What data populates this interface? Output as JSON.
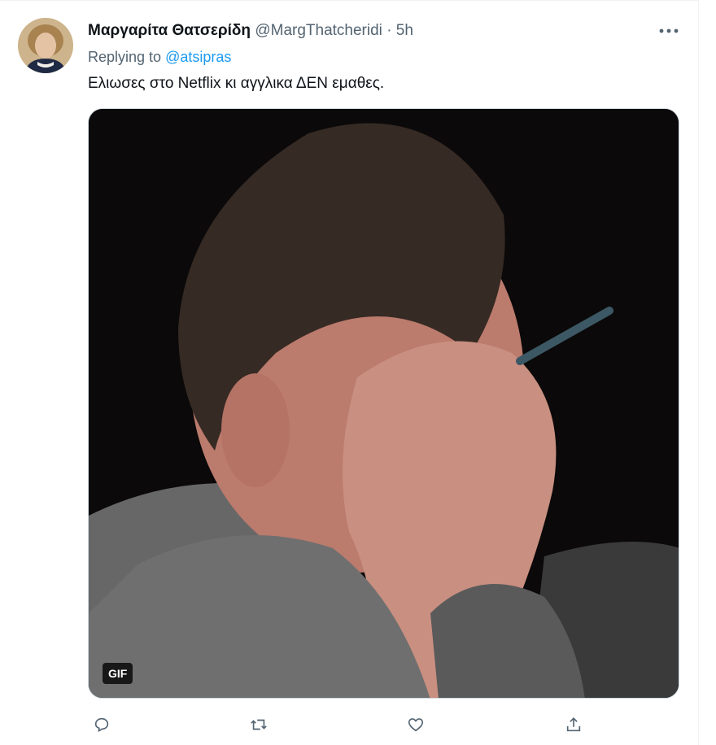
{
  "tweet": {
    "display_name": "Μαργαρίτα Θατσερίδη",
    "handle": "@MargThatcheridi",
    "separator": "·",
    "time": "5h",
    "replying_prefix": "Replying to",
    "replying_to": "@atsipras",
    "text": "Ελιωσες στο Netflix κι αγγλικα ΔΕΝ εμαθες.",
    "media_badge": "GIF"
  },
  "icons": {
    "more": "more-horizontal-icon",
    "reply": "reply-icon",
    "retweet": "retweet-icon",
    "like": "heart-icon",
    "share": "share-icon"
  },
  "colors": {
    "link": "#1d9bf0",
    "secondary_text": "#536471",
    "primary_text": "#0f1419"
  }
}
